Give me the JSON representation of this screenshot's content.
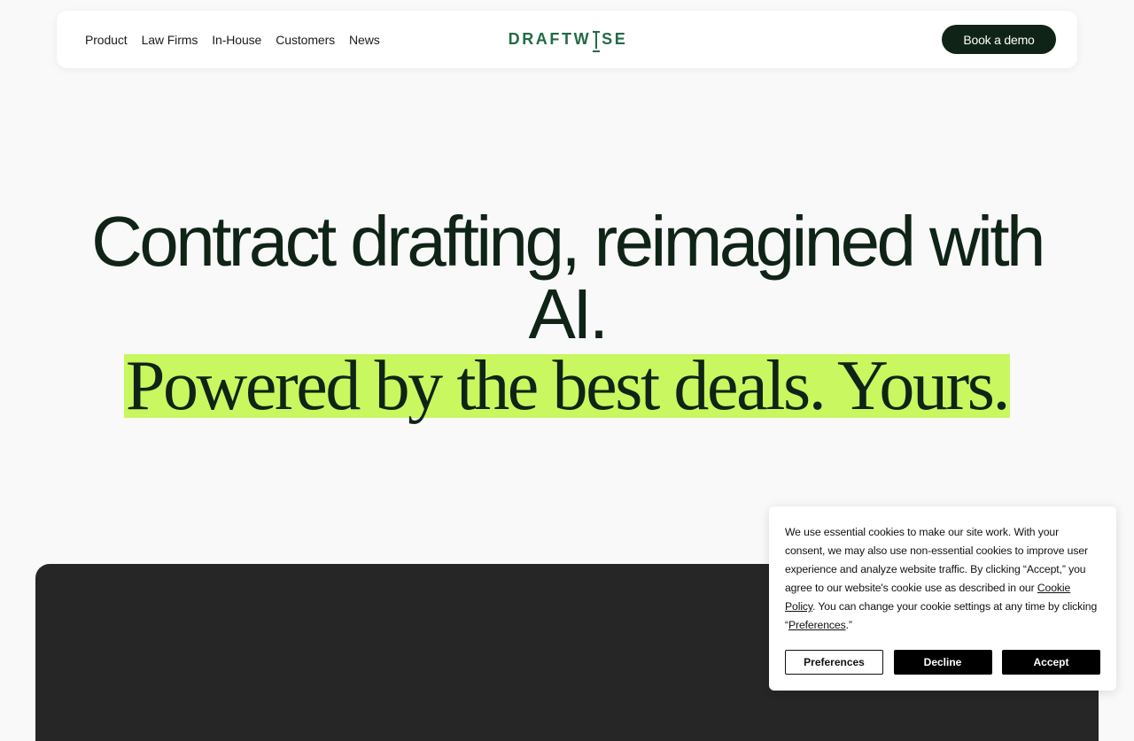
{
  "nav": {
    "links": [
      "Product",
      "Law Firms",
      "In-House",
      "Customers",
      "News"
    ],
    "logo_left": "DRAFTW",
    "logo_right": "SE",
    "cta_label": "Book a demo"
  },
  "hero": {
    "line1": "Contract drafting, reimagined with AI.",
    "line2": "Powered by the best deals. Yours."
  },
  "cookie_banner": {
    "text_part1": "We use essential cookies to make our site work. With your consent, we may also use non-essential cookies to improve user experience and analyze website traffic. By clicking “Accept,” you agree to our website's cookie use as described in our ",
    "cookie_policy_link": "Cookie Policy",
    "text_part2": ". You can change your cookie settings at any time by clicking “",
    "preferences_link": "Preferences",
    "text_part3": ".”",
    "buttons": {
      "preferences": "Preferences",
      "decline": "Decline",
      "accept": "Accept"
    }
  },
  "colors": {
    "brand_dark": "#0f2416",
    "brand_green": "#236b45",
    "highlight": "#c8f75f",
    "background": "#f9f9f9",
    "media_block": "#262626"
  }
}
